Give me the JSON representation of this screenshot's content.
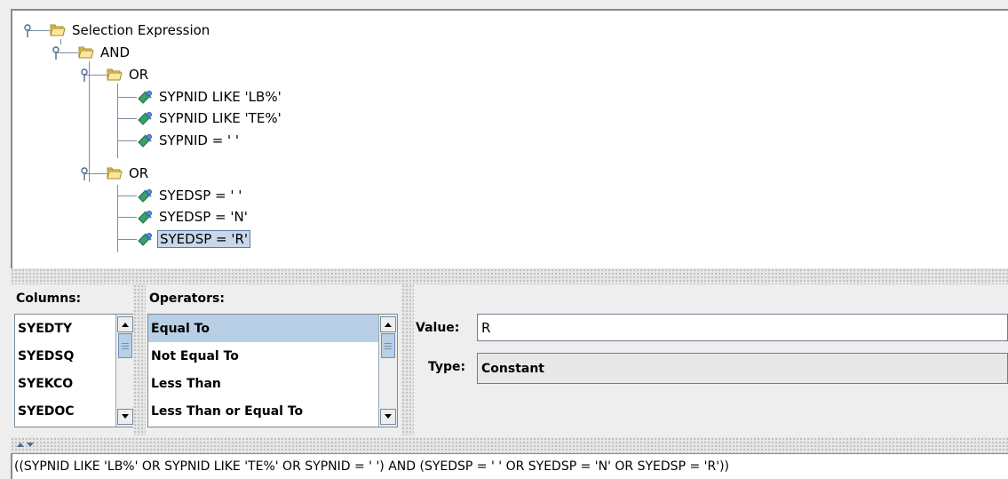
{
  "tree": {
    "root": "Selection Expression",
    "and_label": "AND",
    "or1_label": "OR",
    "or1_children": [
      "SYPNID LIKE 'LB%'",
      "SYPNID LIKE 'TE%'",
      "SYPNID = ' '"
    ],
    "or2_label": "OR",
    "or2_children": [
      "SYEDSP = ' '",
      "SYEDSP = 'N'",
      "SYEDSP = 'R'"
    ],
    "selected_node": "SYEDSP = 'R'"
  },
  "columns": {
    "title": "Columns:",
    "items": [
      "SYEDTY",
      "SYEDSQ",
      "SYEKCO",
      "SYEDOC"
    ]
  },
  "operators": {
    "title": "Operators:",
    "items": [
      "Equal To",
      "Not Equal To",
      "Less Than",
      "Less Than or Equal To"
    ],
    "selected": "Equal To"
  },
  "value_panel": {
    "value_label": "Value:",
    "value": "R",
    "type_label": "Type:",
    "type_value": "Constant"
  },
  "expression": "((SYPNID LIKE 'LB%' OR SYPNID LIKE 'TE%' OR SYPNID = ' ') AND (SYEDSP = ' ' OR SYEDSP = 'N' OR SYEDSP = 'R'))",
  "colors": {
    "selection": "#b8cfe5",
    "tree_line": "#7c8fa6",
    "folder": "#f5d66a"
  }
}
